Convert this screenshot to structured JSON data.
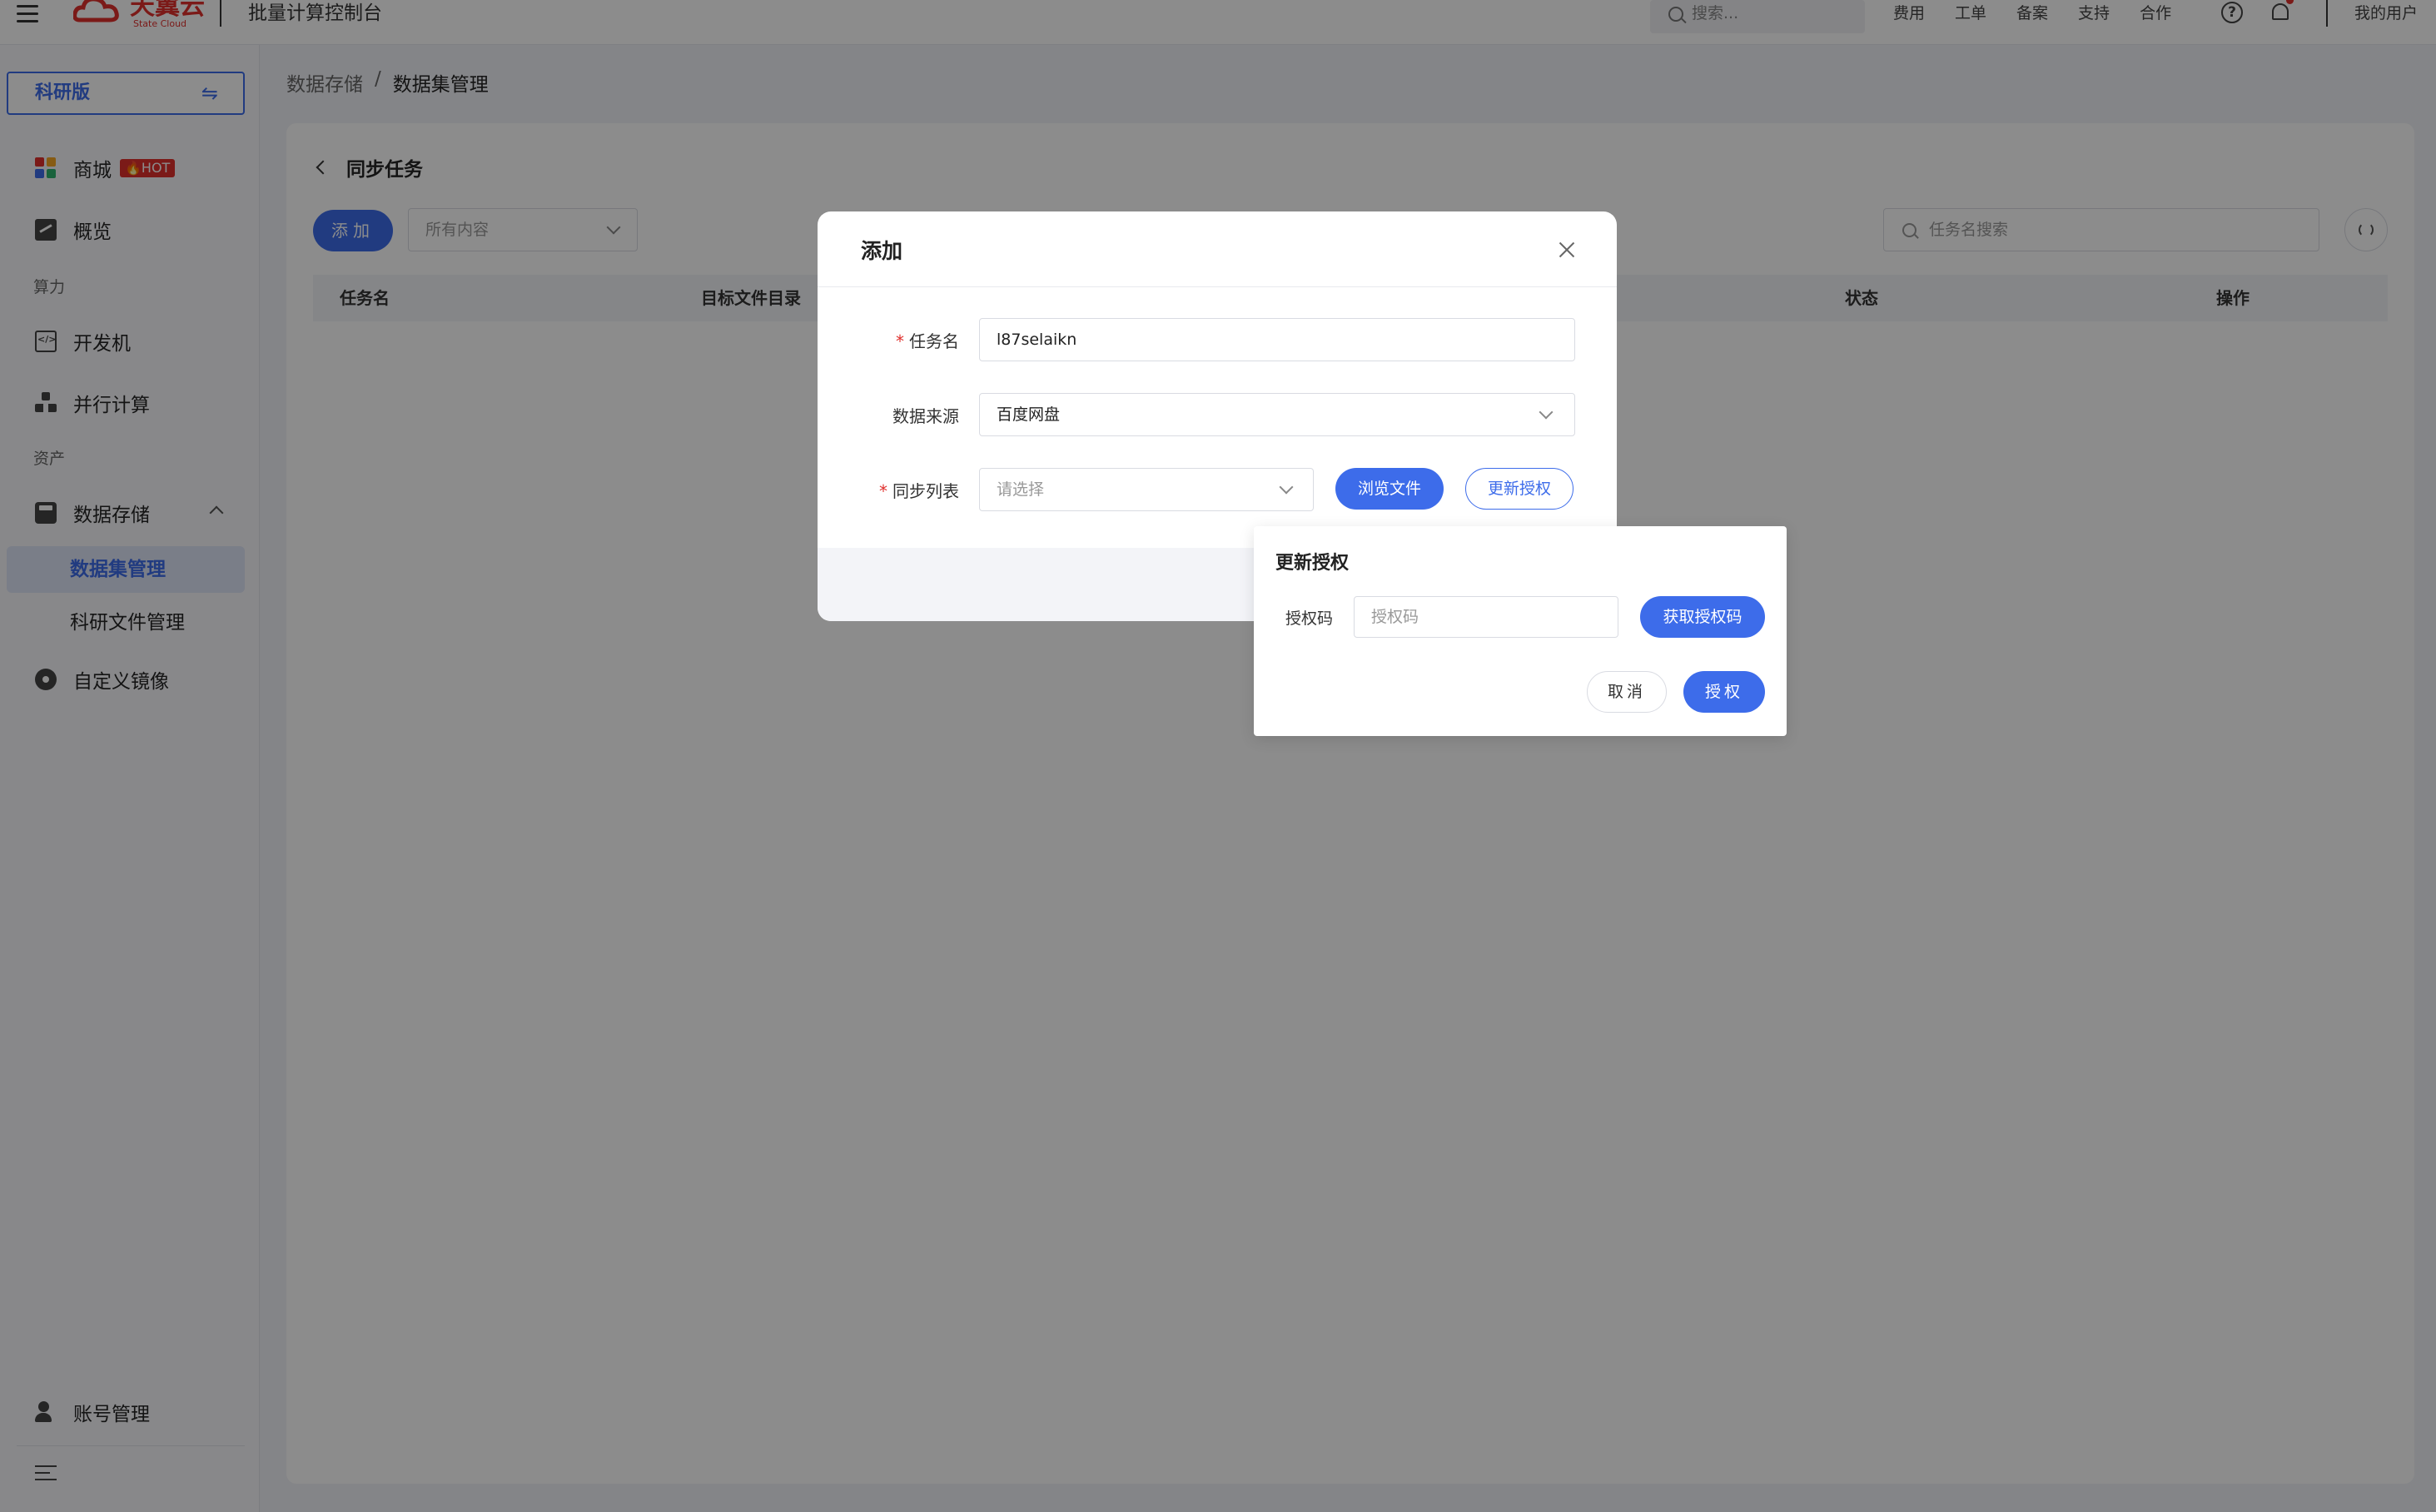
{
  "topbar": {
    "logo_text": "天翼云",
    "logo_sub": "State Cloud",
    "console_title": "批量计算控制台",
    "search_placeholder": "搜索...",
    "links": [
      "费用",
      "工单",
      "备案",
      "支持",
      "合作"
    ],
    "help_symbol": "?",
    "user_label": "我的用户"
  },
  "sidebar": {
    "edition_label": "科研版",
    "edition_swap_icon": "⇋",
    "mall": {
      "label": "商城",
      "badge": "🔥HOT",
      "icon": "grid-icon"
    },
    "overview": {
      "label": "概览",
      "icon": "chart-icon"
    },
    "section_compute": "算力",
    "devmachine": {
      "label": "开发机",
      "icon": "code-icon"
    },
    "parallel": {
      "label": "并行计算",
      "icon": "org-icon"
    },
    "section_assets": "资产",
    "storage": {
      "label": "数据存储",
      "icon": "disk-icon"
    },
    "storage_children": [
      "数据集管理",
      "科研文件管理"
    ],
    "image": {
      "label": "自定义镜像",
      "icon": "cd-icon"
    },
    "account": {
      "label": "账号管理",
      "icon": "user-gear-icon"
    }
  },
  "breadcrumb": {
    "parent": "数据存储",
    "sep": "/",
    "current": "数据集管理"
  },
  "page": {
    "back_title": "同步任务",
    "add_button": "添加",
    "filter_value": "所有内容",
    "search_placeholder": "任务名搜索",
    "table_columns": [
      "任务名",
      "目标文件目录",
      "状态",
      "操作"
    ]
  },
  "modal": {
    "title": "添加",
    "required_mark": "*",
    "task_name_label": "任务名",
    "task_name_value": "l87selaikn",
    "source_label": "数据来源",
    "source_value": "百度网盘",
    "sync_list_label": "同步列表",
    "sync_list_placeholder": "请选择",
    "browse_button": "浏览文件",
    "update_auth_button": "更新授权"
  },
  "popover": {
    "title": "更新授权",
    "code_label": "授权码",
    "code_placeholder": "授权码",
    "get_code_button": "获取授权码",
    "cancel_button": "取消",
    "authorize_button": "授权"
  },
  "colors": {
    "primary": "#3d6cea",
    "brand_red": "#e0302d",
    "overlay": "rgba(0,0,0,0.45)"
  }
}
